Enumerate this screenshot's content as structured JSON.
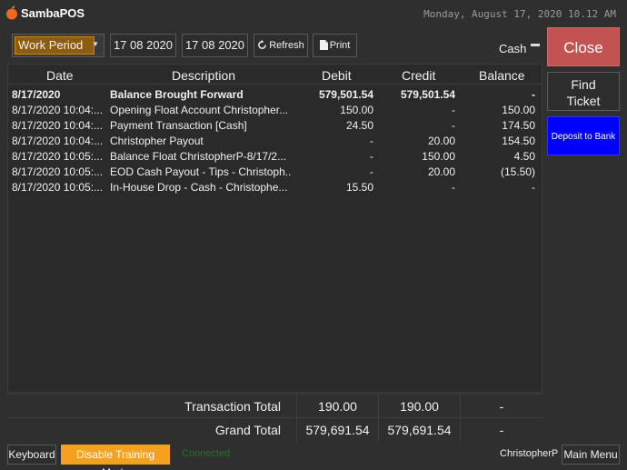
{
  "app": {
    "brand": "SambaPOS",
    "datetime": "Monday, August 17, 2020 10.12 AM"
  },
  "filter": {
    "period_label": "Work Period",
    "start_date": "17 08 2020",
    "end_date": "17 08 2020",
    "refresh_label": "Refresh",
    "print_label": "Print",
    "account_label": "Cash"
  },
  "grid": {
    "columns": [
      "Date",
      "Description",
      "Debit",
      "Credit",
      "Balance"
    ],
    "rows": [
      {
        "date": "8/17/2020",
        "desc": "Balance Brought Forward",
        "debit": "579,501.54",
        "credit": "579,501.54",
        "balance": "-",
        "bold": true
      },
      {
        "date": "8/17/2020 10:04:...",
        "desc": "Opening Float Account Christopher...",
        "debit": "150.00",
        "credit": "-",
        "balance": "150.00"
      },
      {
        "date": "8/17/2020 10:04:...",
        "desc": "Payment Transaction [Cash]",
        "debit": "24.50",
        "credit": "-",
        "balance": "174.50"
      },
      {
        "date": "8/17/2020 10:04:...",
        "desc": "Christopher Payout",
        "debit": "-",
        "credit": "20.00",
        "balance": "154.50"
      },
      {
        "date": "8/17/2020 10:05:...",
        "desc": "Balance Float  ChristopherP-8/17/2...",
        "debit": "-",
        "credit": "150.00",
        "balance": "4.50"
      },
      {
        "date": "8/17/2020 10:05:...",
        "desc": "EOD Cash Payout - Tips - Christoph...",
        "debit": "-",
        "credit": "20.00",
        "balance": "(15.50)"
      },
      {
        "date": "8/17/2020 10:05:...",
        "desc": "In-House Drop - Cash - Christophe...",
        "debit": "15.50",
        "credit": "-",
        "balance": "-"
      }
    ]
  },
  "totals": {
    "transaction": {
      "label": "Transaction Total",
      "debit": "190.00",
      "credit": "190.00",
      "balance": "-"
    },
    "grand": {
      "label": "Grand Total",
      "debit": "579,691.54",
      "credit": "579,691.54",
      "balance": "-"
    }
  },
  "side": {
    "close_label": "Close",
    "find_label_1": "Find",
    "find_label_2": "Ticket",
    "deposit_label": "Deposit to Bank"
  },
  "footer": {
    "keyboard_label": "Keyboard",
    "training_label": "Disable Training Mode",
    "status": "Connected",
    "user": "ChristopherP",
    "main_menu_label": "Main Menu"
  },
  "colors": {
    "close": "#c35352",
    "deposit": "#0000ff",
    "training": "#f5a11c",
    "status": "#1f7a1f"
  },
  "icons": {
    "logo": "sambapos-logo-icon",
    "refresh": "refresh-icon",
    "print": "print-icon",
    "dropdown": "chevron-down-icon"
  }
}
